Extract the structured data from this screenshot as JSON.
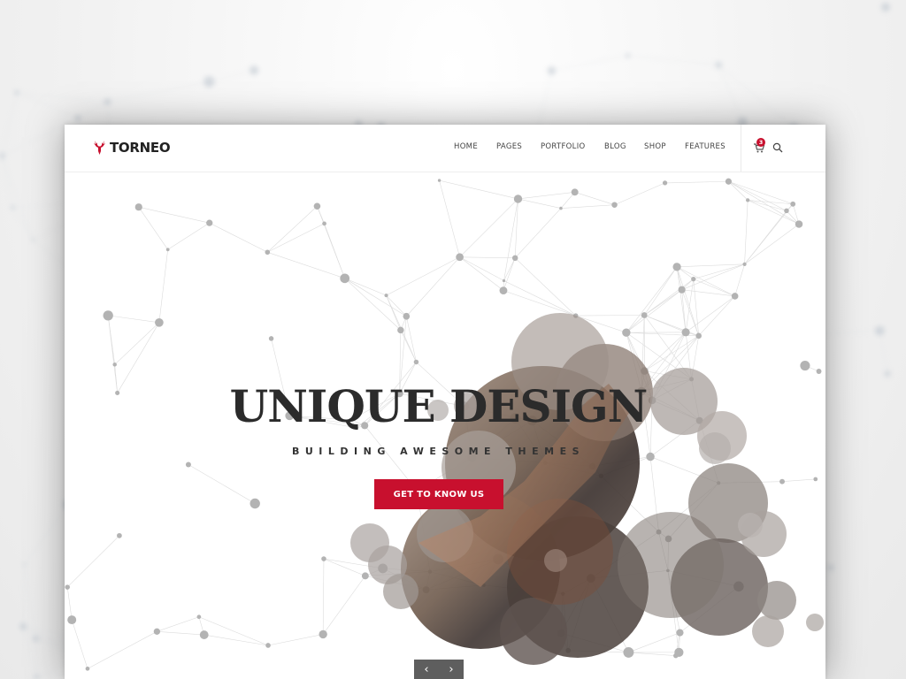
{
  "brand": {
    "name": "TORNEO",
    "accent": "#c8102e",
    "logo_icon": "deer-antler-icon"
  },
  "nav": {
    "items": [
      {
        "label": "HOME"
      },
      {
        "label": "PAGES"
      },
      {
        "label": "PORTFOLIO"
      },
      {
        "label": "BLOG"
      },
      {
        "label": "SHOP"
      },
      {
        "label": "FEATURES"
      }
    ],
    "cart_icon": "cart-icon",
    "cart_count": "3",
    "search_icon": "search-icon"
  },
  "hero": {
    "headline": "UNIQUE DESIGN",
    "subline": "BUILDING AWESOME THEMES",
    "cta_label": "GET TO KNOW US",
    "prev_icon": "chevron-left-icon",
    "next_icon": "chevron-right-icon",
    "prev_glyph": "‹",
    "next_glyph": "›"
  }
}
